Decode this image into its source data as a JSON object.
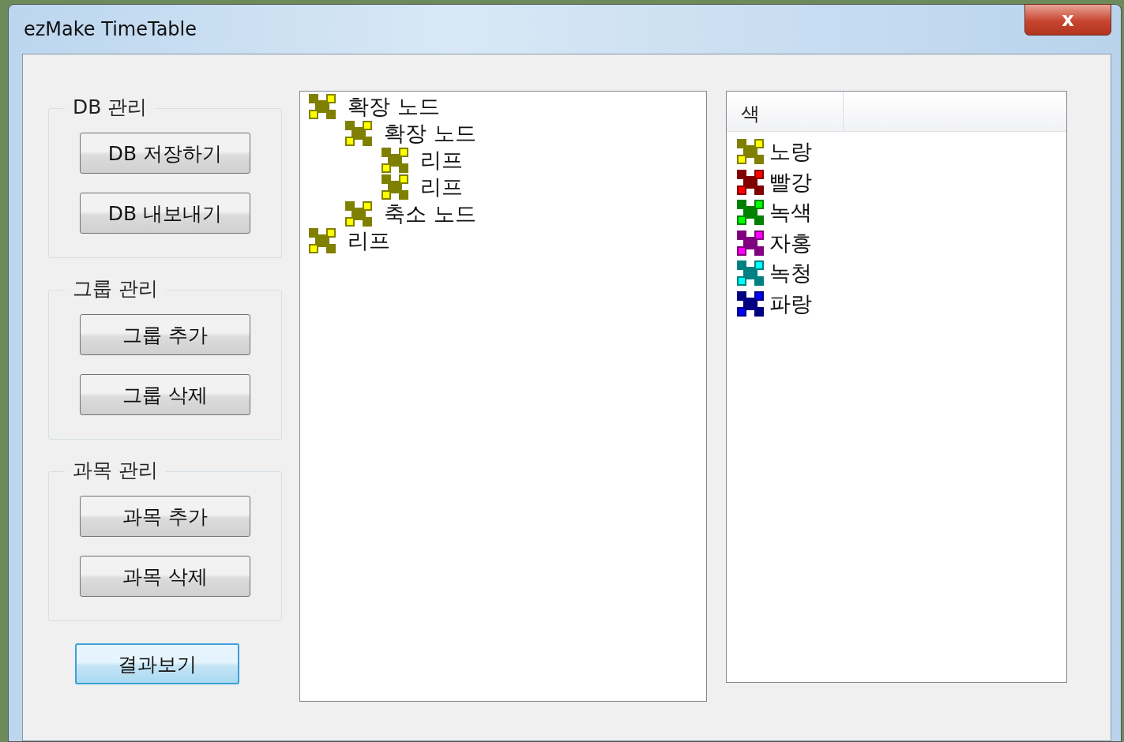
{
  "window": {
    "title": "ezMake TimeTable",
    "close_glyph": "x"
  },
  "groups": [
    {
      "title": "DB 관리",
      "buttons": [
        {
          "label": "DB 저장하기"
        },
        {
          "label": "DB 내보내기"
        }
      ]
    },
    {
      "title": "그룹 관리",
      "buttons": [
        {
          "label": "그룹 추가"
        },
        {
          "label": "그룹 삭제"
        }
      ]
    },
    {
      "title": "과목 관리",
      "buttons": [
        {
          "label": "과목 추가"
        },
        {
          "label": "과목 삭제"
        }
      ]
    }
  ],
  "result_button": {
    "label": "결과보기",
    "focused": true
  },
  "tree": [
    {
      "label": "확장 노드",
      "children": [
        {
          "label": "확장 노드",
          "children": [
            {
              "label": "리프"
            },
            {
              "label": "리프"
            }
          ]
        },
        {
          "label": "축소 노드"
        }
      ]
    },
    {
      "label": "리프"
    }
  ],
  "color_list": {
    "columns": [
      "색"
    ],
    "items": [
      {
        "name": "노랑",
        "color": "#808000"
      },
      {
        "name": "빨강",
        "color": "#800000"
      },
      {
        "name": "녹색",
        "color": "#008000"
      },
      {
        "name": "자홍",
        "color": "#800080"
      },
      {
        "name": "녹청",
        "color": "#008080"
      },
      {
        "name": "파랑",
        "color": "#000080"
      }
    ]
  }
}
